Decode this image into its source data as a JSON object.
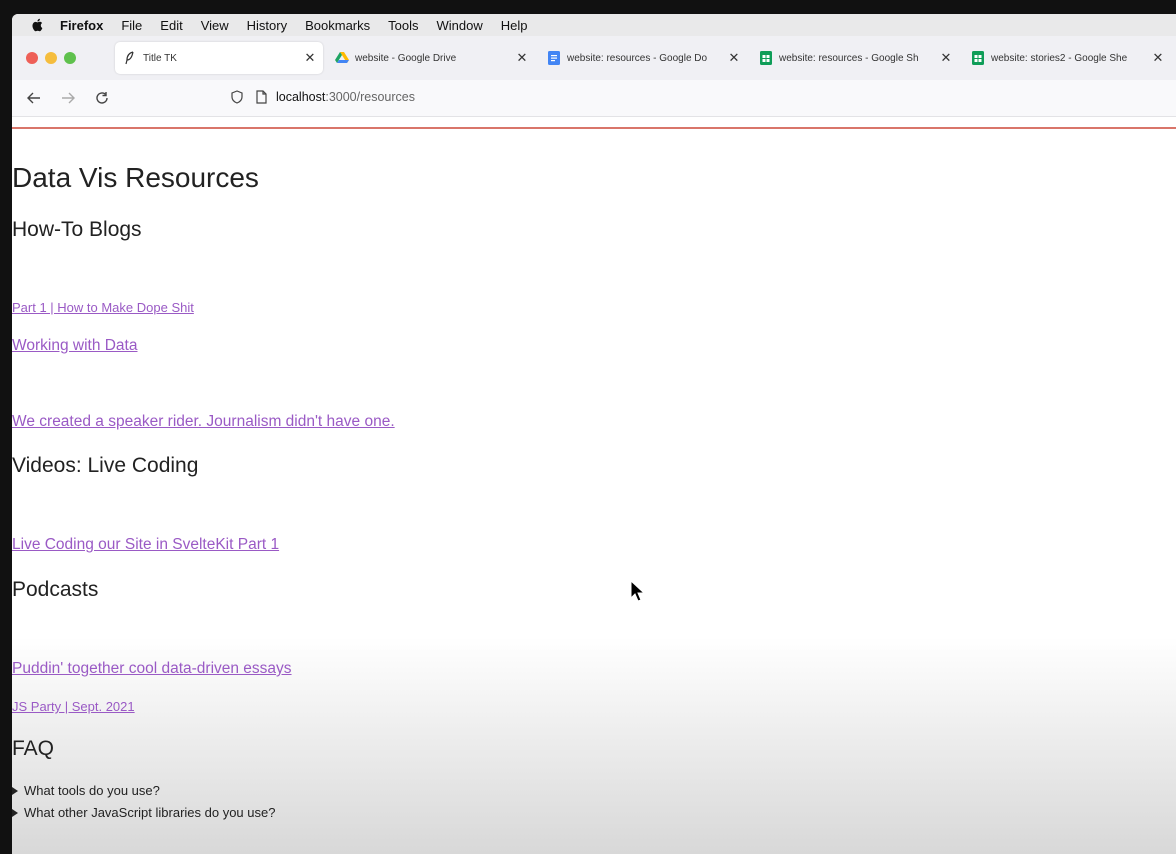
{
  "menubar": {
    "app": "Firefox",
    "items": [
      "File",
      "Edit",
      "View",
      "History",
      "Bookmarks",
      "Tools",
      "Window",
      "Help"
    ]
  },
  "tabs": [
    {
      "label": "Title TK",
      "icon": "feather-icon",
      "active": true
    },
    {
      "label": "website - Google Drive",
      "icon": "google-drive-icon",
      "active": false
    },
    {
      "label": "website: resources - Google Do",
      "icon": "google-docs-icon",
      "active": false
    },
    {
      "label": "website: resources - Google Sh",
      "icon": "google-sheets-icon",
      "active": false
    },
    {
      "label": "website: stories2 - Google She",
      "icon": "google-sheets-icon",
      "active": false
    }
  ],
  "address": {
    "host": "localhost",
    "path": ":3000/resources"
  },
  "page": {
    "title": "Data Vis Resources",
    "sections": {
      "blogs": {
        "heading": "How-To Blogs",
        "links": [
          "Part 1 | How to Make Dope Shit",
          "Working with Data",
          "We created a speaker rider. Journalism didn't have one."
        ]
      },
      "videos": {
        "heading": "Videos: Live Coding",
        "links": [
          "Live Coding our Site in SvelteKit Part 1"
        ]
      },
      "podcasts": {
        "heading": "Podcasts",
        "links": [
          "Puddin' together cool data-driven essays",
          "JS Party | Sept. 2021"
        ]
      },
      "faq": {
        "heading": "FAQ",
        "items": [
          "What tools do you use?",
          "What other JavaScript libraries do you use?"
        ]
      }
    }
  },
  "colors": {
    "link": "#9a5ac5",
    "accent_line": "#d9756a",
    "traffic_red": "#ee5f57",
    "traffic_yellow": "#f5bd3d",
    "traffic_green": "#5fc14d"
  }
}
